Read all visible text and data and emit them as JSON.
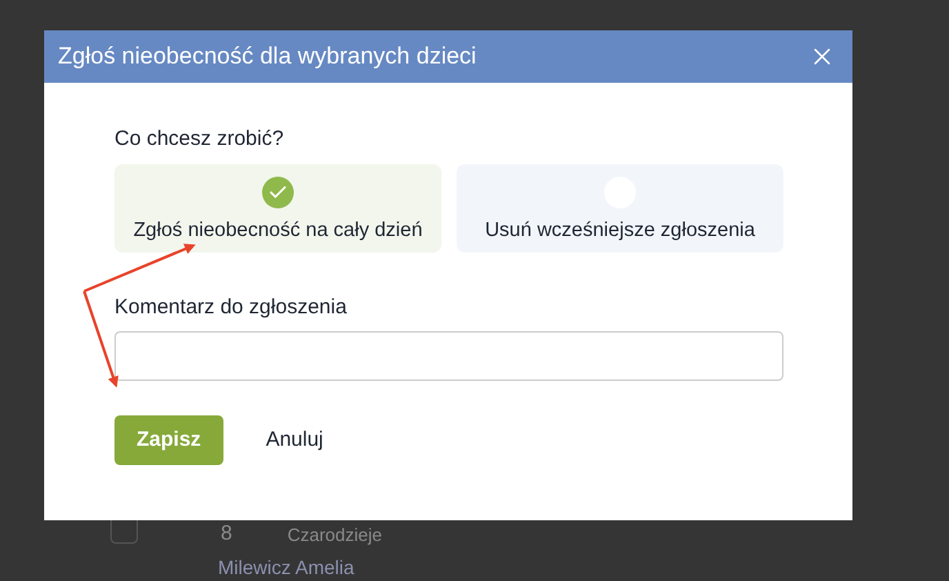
{
  "background": {
    "row": {
      "checked": false,
      "number": "8",
      "group": "Czarodzieje"
    },
    "next_name": "Milewicz Amelia"
  },
  "dialog": {
    "title": "Zgłoś nieobecność dla wybranych dzieci",
    "question": "Co chcesz zrobić?",
    "options": [
      {
        "label": "Zgłoś nieobecność na cały dzień",
        "selected": true
      },
      {
        "label": "Usuń wcześniejsze zgłoszenia",
        "selected": false
      }
    ],
    "comment": {
      "label": "Komentarz do zgłoszenia"
    },
    "buttons": [
      {
        "label": "Zapisz",
        "kind": "primary"
      },
      {
        "label": "Anuluj",
        "kind": "link"
      }
    ]
  }
}
